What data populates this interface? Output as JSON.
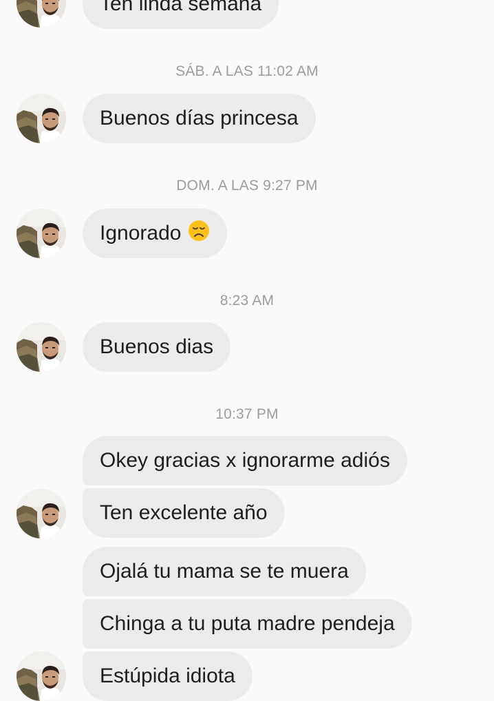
{
  "messages": {
    "m0": "Ten linda semana",
    "ts1": "SÁB. A LAS 11:02 AM",
    "m1": "Buenos días princesa",
    "ts2": "DOM. A LAS 9:27 PM",
    "m2": "Ignorado",
    "m2_emoji": "disappointed-face-emoji",
    "ts3": "8:23 AM",
    "m3": "Buenos dias",
    "ts4": "10:37 PM",
    "m4": "Okey gracias x ignorarme adiós",
    "m5": "Ten excelente año",
    "m6": "Ojalá tu mama se te muera",
    "m7": "Chinga a tu puta madre pendeja",
    "m8": "Estúpida idiota"
  },
  "colors": {
    "background": "#fafafa",
    "bubble": "#ebebeb",
    "timestamp": "#9c9c9c",
    "text": "#1c1e21"
  }
}
